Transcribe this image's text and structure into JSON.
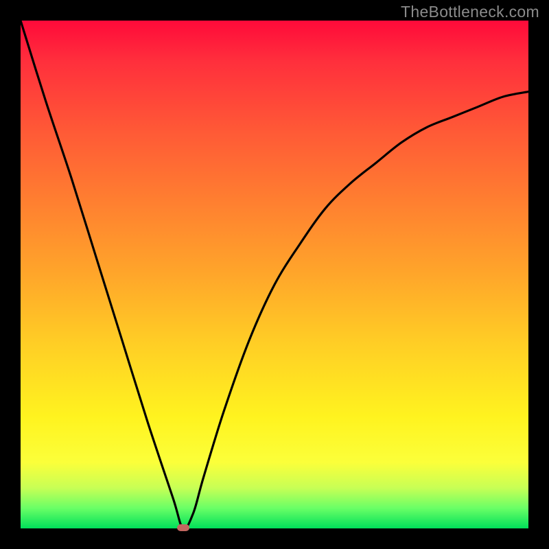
{
  "watermark": "TheBottleneck.com",
  "chart_data": {
    "type": "line",
    "title": "",
    "xlabel": "",
    "ylabel": "",
    "xlim": [
      0,
      100
    ],
    "ylim": [
      0,
      100
    ],
    "grid": false,
    "series": [
      {
        "name": "bottleneck-curve",
        "x": [
          0,
          5,
          10,
          15,
          20,
          25,
          30,
          32,
          34,
          36,
          40,
          45,
          50,
          55,
          60,
          65,
          70,
          75,
          80,
          85,
          90,
          95,
          100
        ],
        "y": [
          100,
          84,
          69,
          53,
          37,
          21,
          6,
          0,
          3,
          10,
          23,
          37,
          48,
          56,
          63,
          68,
          72,
          76,
          79,
          81,
          83,
          85,
          86
        ]
      }
    ],
    "color_scale": {
      "type": "vertical-gradient",
      "stops": [
        {
          "pos": 0.0,
          "color": "#ff0a3a"
        },
        {
          "pos": 0.5,
          "color": "#ffa62a"
        },
        {
          "pos": 0.8,
          "color": "#fff31f"
        },
        {
          "pos": 1.0,
          "color": "#00e05a"
        }
      ]
    },
    "marker": {
      "x": 32,
      "y": 0,
      "color": "#c36760"
    }
  }
}
